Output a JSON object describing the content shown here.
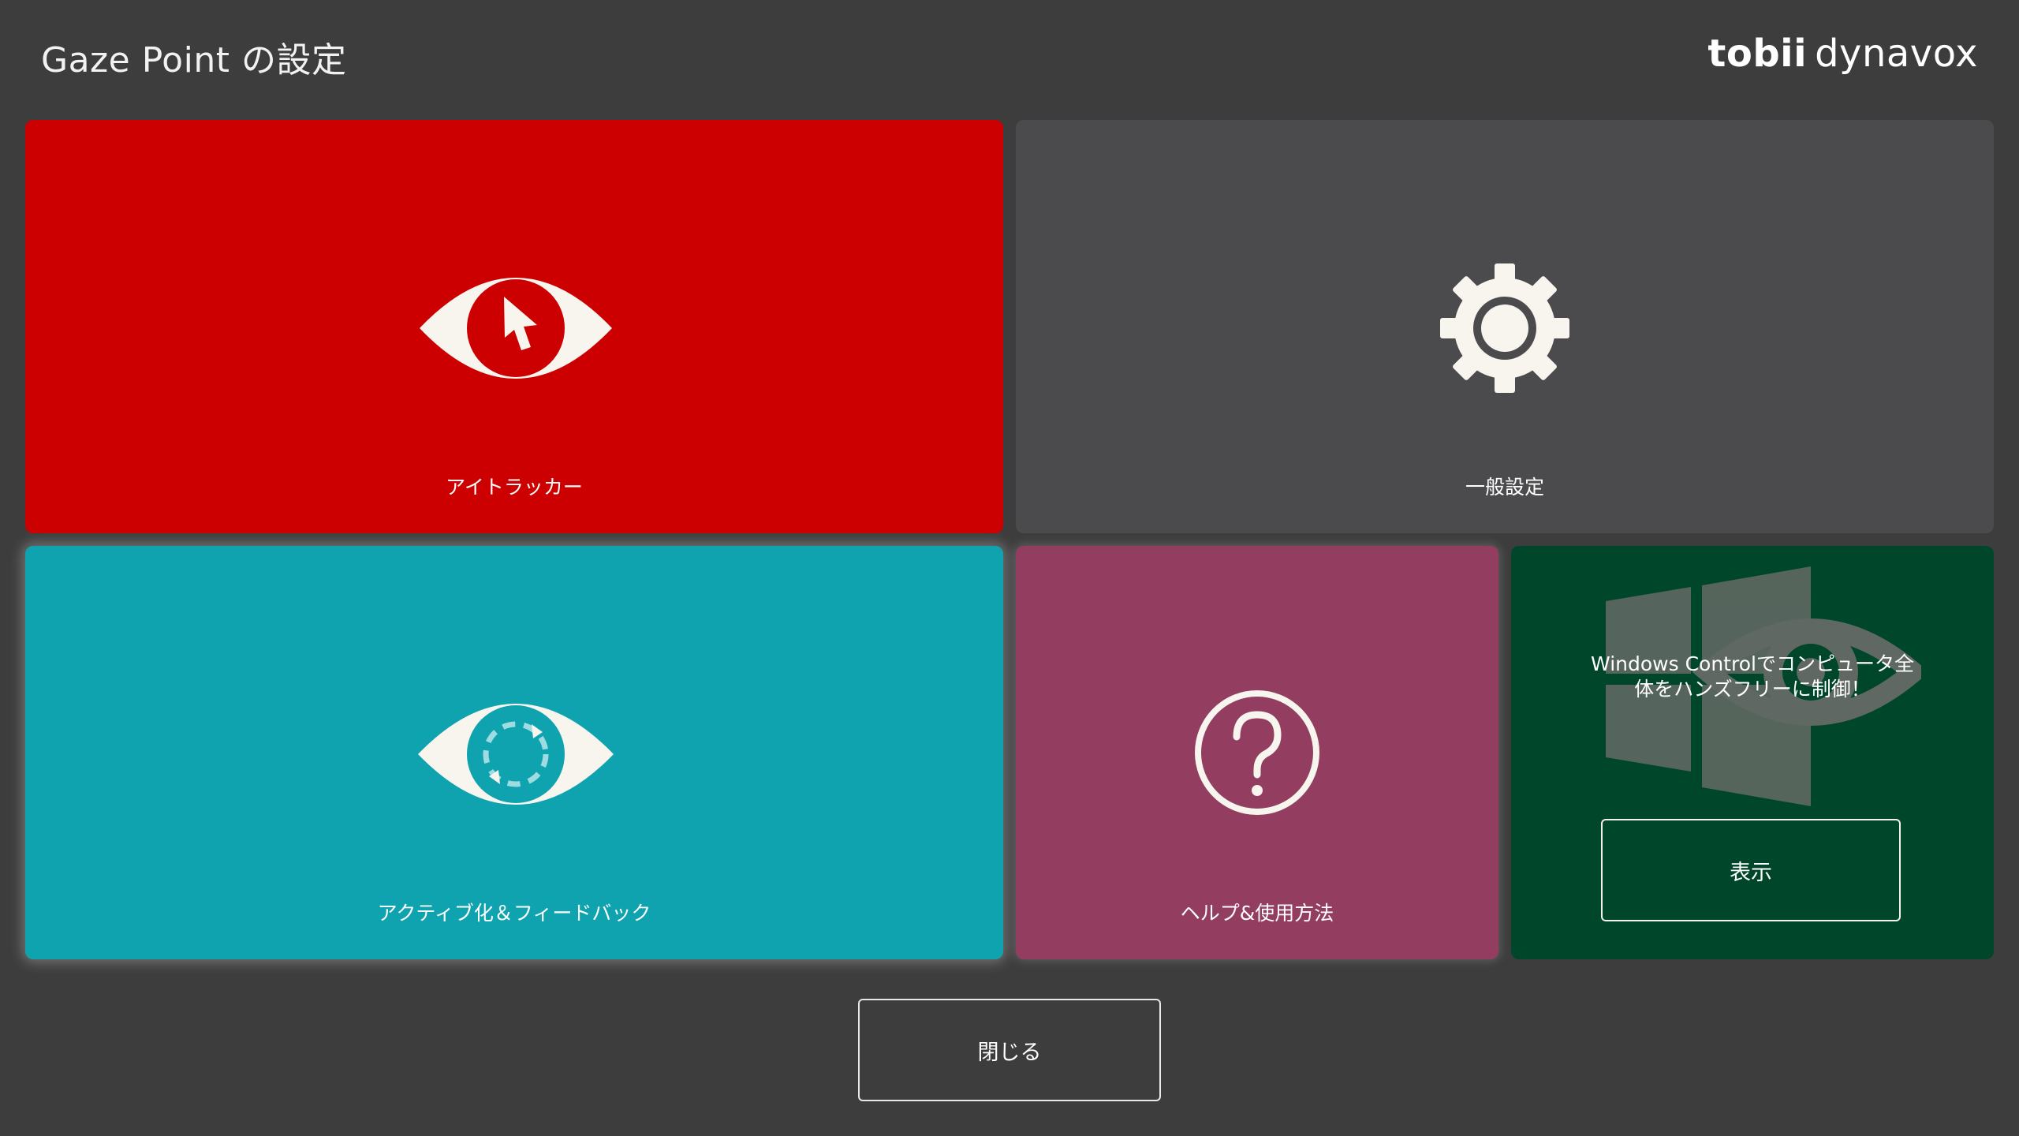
{
  "header": {
    "title": "Gaze Point の設定",
    "brand_bold": "tobii",
    "brand_light": "dynavox"
  },
  "tiles": {
    "eye_tracker": {
      "label": "アイトラッカー",
      "icon": "eye-cursor-icon",
      "color": "#cc0000"
    },
    "general": {
      "label": "一般設定",
      "icon": "gear-icon",
      "color": "#4b4b4d"
    },
    "activation": {
      "label": "アクティブ化＆フィードバック",
      "icon": "eye-refresh-icon",
      "color": "#0fa3b0"
    },
    "help": {
      "label": "ヘルプ&使用方法",
      "icon": "question-circle-icon",
      "color": "#933e60"
    },
    "windows_control": {
      "text": "Windows Controlでコンピュータ全体をハンズフリーに制御！",
      "button_label": "表示",
      "icon": "windows-eye-logo-icon",
      "color": "#00462b"
    }
  },
  "footer": {
    "close_label": "閉じる"
  },
  "colors": {
    "background": "#3d3d3d",
    "icon_fill": "#f7f5ee"
  }
}
